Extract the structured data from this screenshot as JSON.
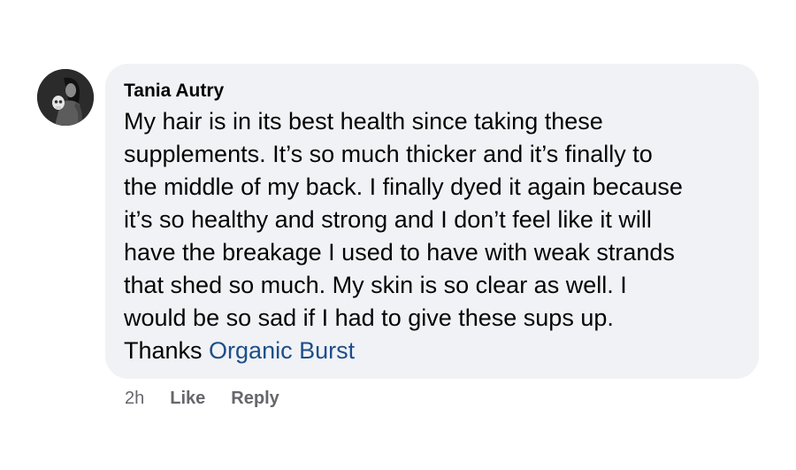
{
  "comment": {
    "author": "Tania Autry",
    "lines": [
      "My hair is in its best health since taking these",
      "supplements. It’s so much thicker and it’s finally to",
      "the middle of my back. I finally dyed it again because",
      "it’s so healthy and strong and I don’t feel like it will",
      "have the breakage I used to have with weak strands",
      "that shed so much. My skin is so clear as well. I",
      "would be so sad if I had to give these sups up."
    ],
    "last_line_prefix": "Thanks ",
    "mention": "Organic Burst",
    "timestamp": "2h",
    "like_label": "Like",
    "reply_label": "Reply"
  },
  "colors": {
    "bubble_background": "#f0f2f5",
    "text": "#050505",
    "mention": "#1d4e89",
    "meta": "#65676b"
  }
}
